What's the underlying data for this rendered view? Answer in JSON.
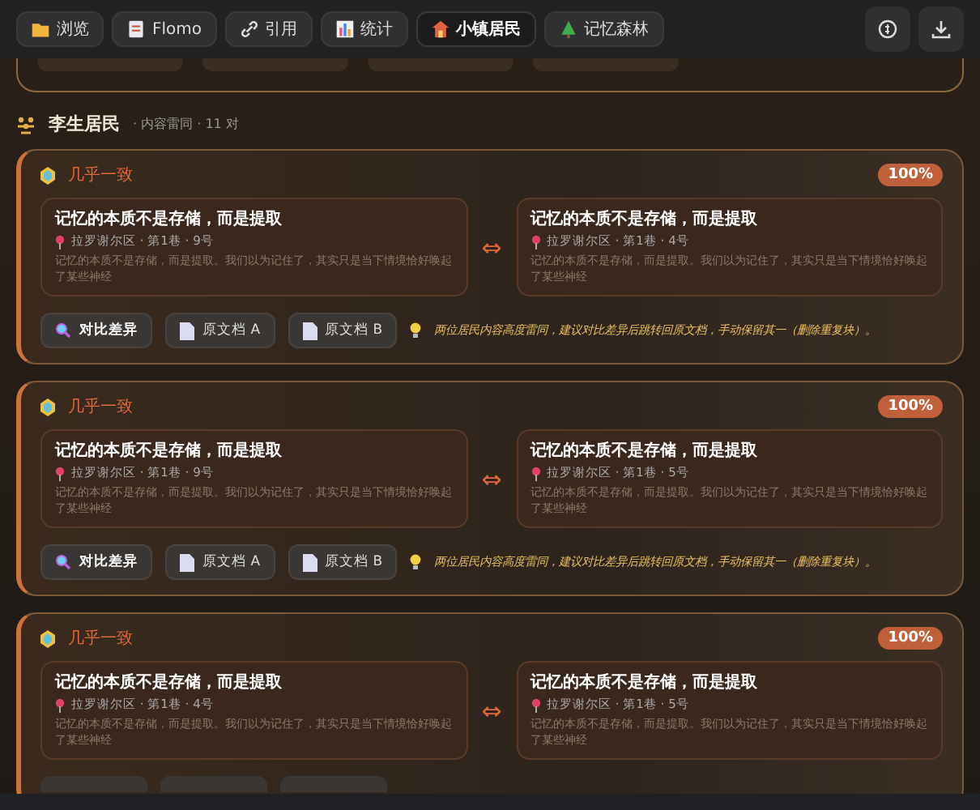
{
  "toolbar": {
    "tabs": [
      {
        "label": "浏览",
        "selected": false
      },
      {
        "label": "Flomo",
        "selected": false
      },
      {
        "label": "引用",
        "selected": false
      },
      {
        "label": "统计",
        "selected": false
      },
      {
        "label": "小镇居民",
        "selected": true
      },
      {
        "label": "记忆森林",
        "selected": false
      }
    ]
  },
  "group": {
    "name": "李生居民",
    "summary": "· 内容雷同 · 11 对"
  },
  "pairs": [
    {
      "label": "几乎一致",
      "score": "100%",
      "left": {
        "title": "记忆的本质不是存储，而是提取",
        "location": "拉罗谢尔区 · 第1巷 · 9号",
        "excerpt": "记忆的本质不是存储，而是提取。我们以为记住了，其实只是当下情境恰好唤起了某些神经"
      },
      "right": {
        "title": "记忆的本质不是存储，而是提取",
        "location": "拉罗谢尔区 · 第1巷 · 4号",
        "excerpt": "记忆的本质不是存储，而是提取。我们以为记住了，其实只是当下情境恰好唤起了某些神经"
      },
      "arrow": "⇔",
      "actions": [
        "对比差异",
        "原文档 A",
        "原文档 B"
      ],
      "hint": "两位居民内容高度雷同，建议对比差异后跳转回原文档，手动保留其一（删除重复块）。"
    },
    {
      "label": "几乎一致",
      "score": "100%",
      "left": {
        "title": "记忆的本质不是存储，而是提取",
        "location": "拉罗谢尔区 · 第1巷 · 9号",
        "excerpt": "记忆的本质不是存储，而是提取。我们以为记住了，其实只是当下情境恰好唤起了某些神经"
      },
      "right": {
        "title": "记忆的本质不是存储，而是提取",
        "location": "拉罗谢尔区 · 第1巷 · 5号",
        "excerpt": "记忆的本质不是存储，而是提取。我们以为记住了，其实只是当下情境恰好唤起了某些神经"
      },
      "arrow": "⇔",
      "actions": [
        "对比差异",
        "原文档 A",
        "原文档 B"
      ],
      "hint": "两位居民内容高度雷同，建议对比差异后跳转回原文档，手动保留其一（删除重复块）。"
    },
    {
      "label": "几乎一致",
      "score": "100%",
      "left": {
        "title": "记忆的本质不是存储，而是提取",
        "location": "拉罗谢尔区 · 第1巷 · 4号",
        "excerpt": "记忆的本质不是存储，而是提取。我们以为记住了，其实只是当下情境恰好唤起了某些神经"
      },
      "right": {
        "title": "记忆的本质不是存储，而是提取",
        "location": "拉罗谢尔区 · 第1巷 · 5号",
        "excerpt": "记忆的本质不是存储，而是提取。我们以为记住了，其实只是当下情境恰好唤起了某些神经"
      },
      "arrow": "⇔"
    }
  ]
}
